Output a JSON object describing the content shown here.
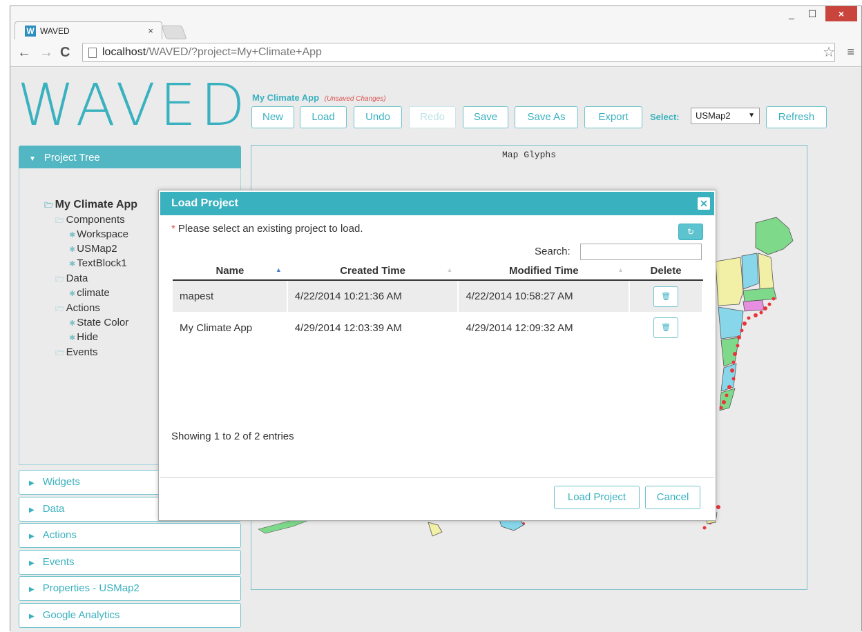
{
  "browser": {
    "tab_title": "WAVED",
    "tab_close": "×",
    "favicon": "W",
    "url_host": "localhost",
    "url_rest": "/WAVED/?project=My+Climate+App",
    "window_close": "×",
    "window_min": "_",
    "window_max": "☐"
  },
  "app": {
    "logo": "WAVED",
    "project_name": "My Climate App",
    "unsaved": "(Unsaved Changes)",
    "buttons": {
      "new": "New",
      "load": "Load",
      "undo": "Undo",
      "redo": "Redo",
      "save": "Save",
      "save_as": "Save As",
      "export": "Export",
      "refresh": "Refresh"
    },
    "select_label": "Select:",
    "select_value": "USMap2"
  },
  "sidebar": {
    "project_tree": "Project Tree",
    "tree": {
      "root": "My Climate App",
      "components": "Components",
      "workspace": "Workspace",
      "usmap2": "USMap2",
      "textblock1": "TextBlock1",
      "data": "Data",
      "climate": "climate",
      "actions": "Actions",
      "state_color": "State Color",
      "hide": "Hide",
      "events": "Events"
    },
    "panels": [
      "Widgets",
      "Data",
      "Actions",
      "Events",
      "Properties - USMap2",
      "Google Analytics"
    ]
  },
  "map": {
    "title": "Map Glyphs"
  },
  "modal": {
    "title": "Load Project",
    "note": "Please select an existing project to load.",
    "required_mark": "*",
    "search_label": "Search:",
    "columns": [
      "Name",
      "Created Time",
      "Modified Time",
      "Delete"
    ],
    "rows": [
      {
        "name": "mapest",
        "created": "4/22/2014 10:21:36 AM",
        "modified": "4/22/2014 10:58:27 AM"
      },
      {
        "name": "My Climate App",
        "created": "4/29/2014 12:03:39 AM",
        "modified": "4/29/2014 12:09:32 AM"
      }
    ],
    "info": "Showing 1 to 2 of 2 entries",
    "load_button": "Load Project",
    "cancel_button": "Cancel"
  },
  "colors": {
    "accent": "#3ab1bf",
    "danger": "#d9534f"
  },
  "icons": {
    "close": "close-icon",
    "refresh": "refresh-icon",
    "trash": "trash-icon",
    "folder": "folder-icon",
    "gear": "gear-icon"
  }
}
